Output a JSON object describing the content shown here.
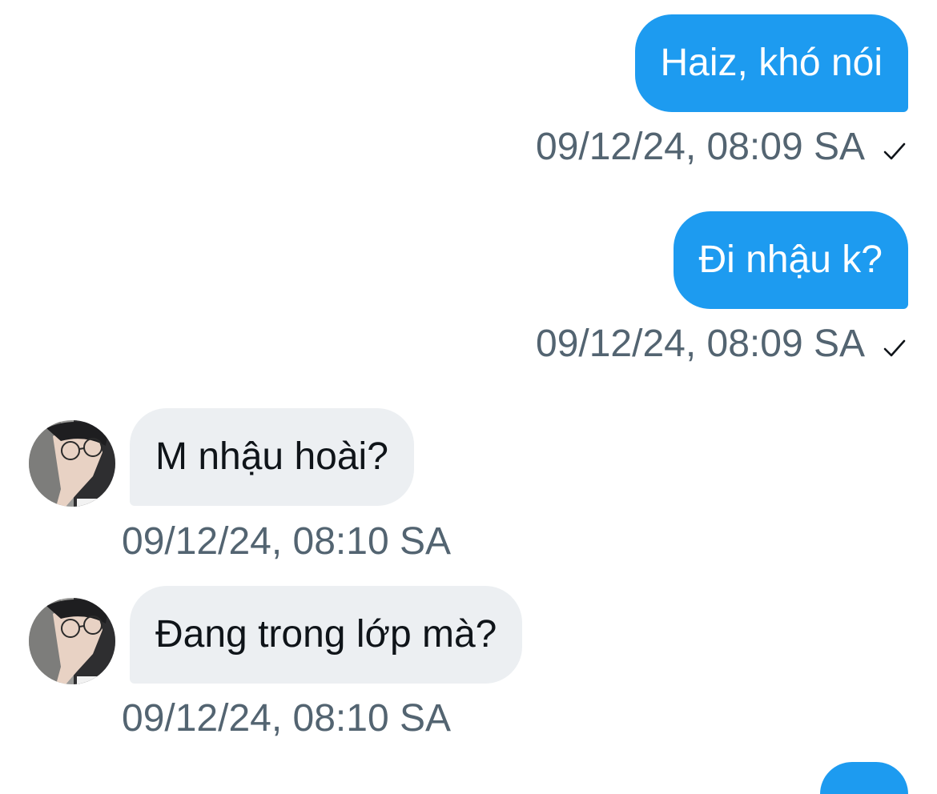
{
  "conversation": {
    "messages": [
      {
        "direction": "outgoing",
        "text": "Haiz, khó nói",
        "time": "09/12/24, 08:09 SA"
      },
      {
        "direction": "outgoing",
        "text": "Đi nhậu k?",
        "time": "09/12/24, 08:09 SA"
      },
      {
        "direction": "incoming",
        "text": "M nhậu hoài?",
        "time": "09/12/24, 08:10 SA"
      },
      {
        "direction": "incoming",
        "text": "Đang trong lớp mà?",
        "time": "09/12/24, 08:10 SA"
      }
    ]
  },
  "icons": {
    "sent_status": "checkmark-icon",
    "avatar": "profile-photo"
  },
  "colors": {
    "outgoing_bubble": "#1d9bf0",
    "incoming_bubble": "#eceff2",
    "timestamp": "#536471"
  }
}
